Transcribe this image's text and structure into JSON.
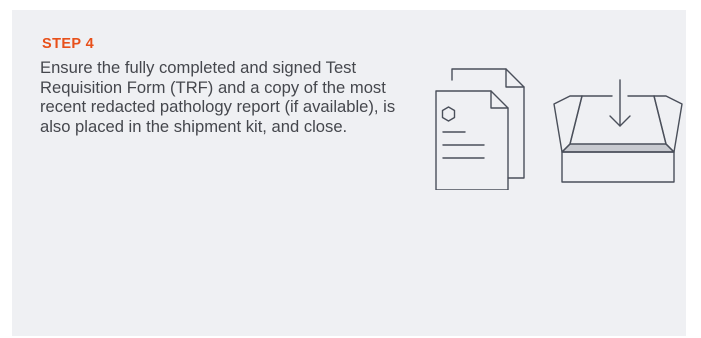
{
  "step": {
    "label": "STEP 4",
    "text": "Ensure the fully completed and signed Test Requisition Form (TRF) and a copy of the most recent redacted pathology report (if available), is also placed in the shipment kit, and close."
  },
  "icons": {
    "documents": "documents-icon",
    "shipment_box": "shipment-box-icon"
  },
  "colors": {
    "accent": "#e8501a",
    "text": "#45474d",
    "card_background": "#eff0f3",
    "icon_stroke": "#4a4f5a"
  }
}
